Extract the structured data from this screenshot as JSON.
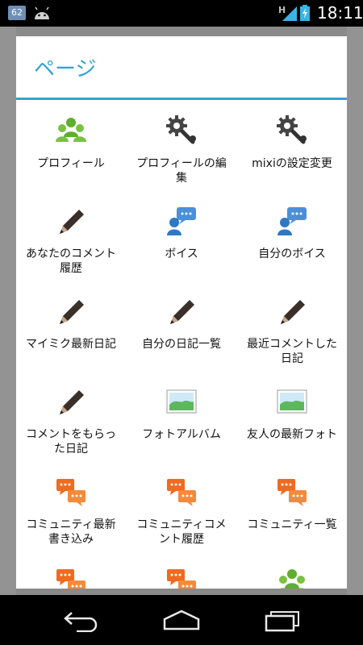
{
  "statusbar": {
    "notification_count": "62",
    "network": "H",
    "time": "18:11"
  },
  "dialog": {
    "title": "ページ",
    "items": [
      {
        "label": "プロフィール",
        "icon": "people-icon"
      },
      {
        "label": "プロフィールの編集",
        "icon": "gear-wrench-icon"
      },
      {
        "label": "mixiの設定変更",
        "icon": "gear-wrench-icon"
      },
      {
        "label": "あなたのコメント履歴",
        "icon": "pencil-icon"
      },
      {
        "label": "ボイス",
        "icon": "voice-icon"
      },
      {
        "label": "自分のボイス",
        "icon": "voice-icon"
      },
      {
        "label": "マイミク最新日記",
        "icon": "pencil-icon"
      },
      {
        "label": "自分の日記一覧",
        "icon": "pencil-icon"
      },
      {
        "label": "最近コメントした日記",
        "icon": "pencil-icon"
      },
      {
        "label": "コメントをもらった日記",
        "icon": "pencil-icon"
      },
      {
        "label": "フォトアルバム",
        "icon": "photo-icon"
      },
      {
        "label": "友人の最新フォト",
        "icon": "photo-icon"
      },
      {
        "label": "コミュニティ最新書き込み",
        "icon": "community-icon"
      },
      {
        "label": "コミュニティコメント履歴",
        "icon": "community-icon"
      },
      {
        "label": "コミュニティ一覧",
        "icon": "community-icon"
      },
      {
        "label": "",
        "icon": "community-icon"
      },
      {
        "label": "",
        "icon": "community-icon"
      },
      {
        "label": "",
        "icon": "people-icon"
      }
    ]
  },
  "navbar": {
    "back": "back-icon",
    "home": "home-icon",
    "recents": "recent-apps-icon"
  }
}
